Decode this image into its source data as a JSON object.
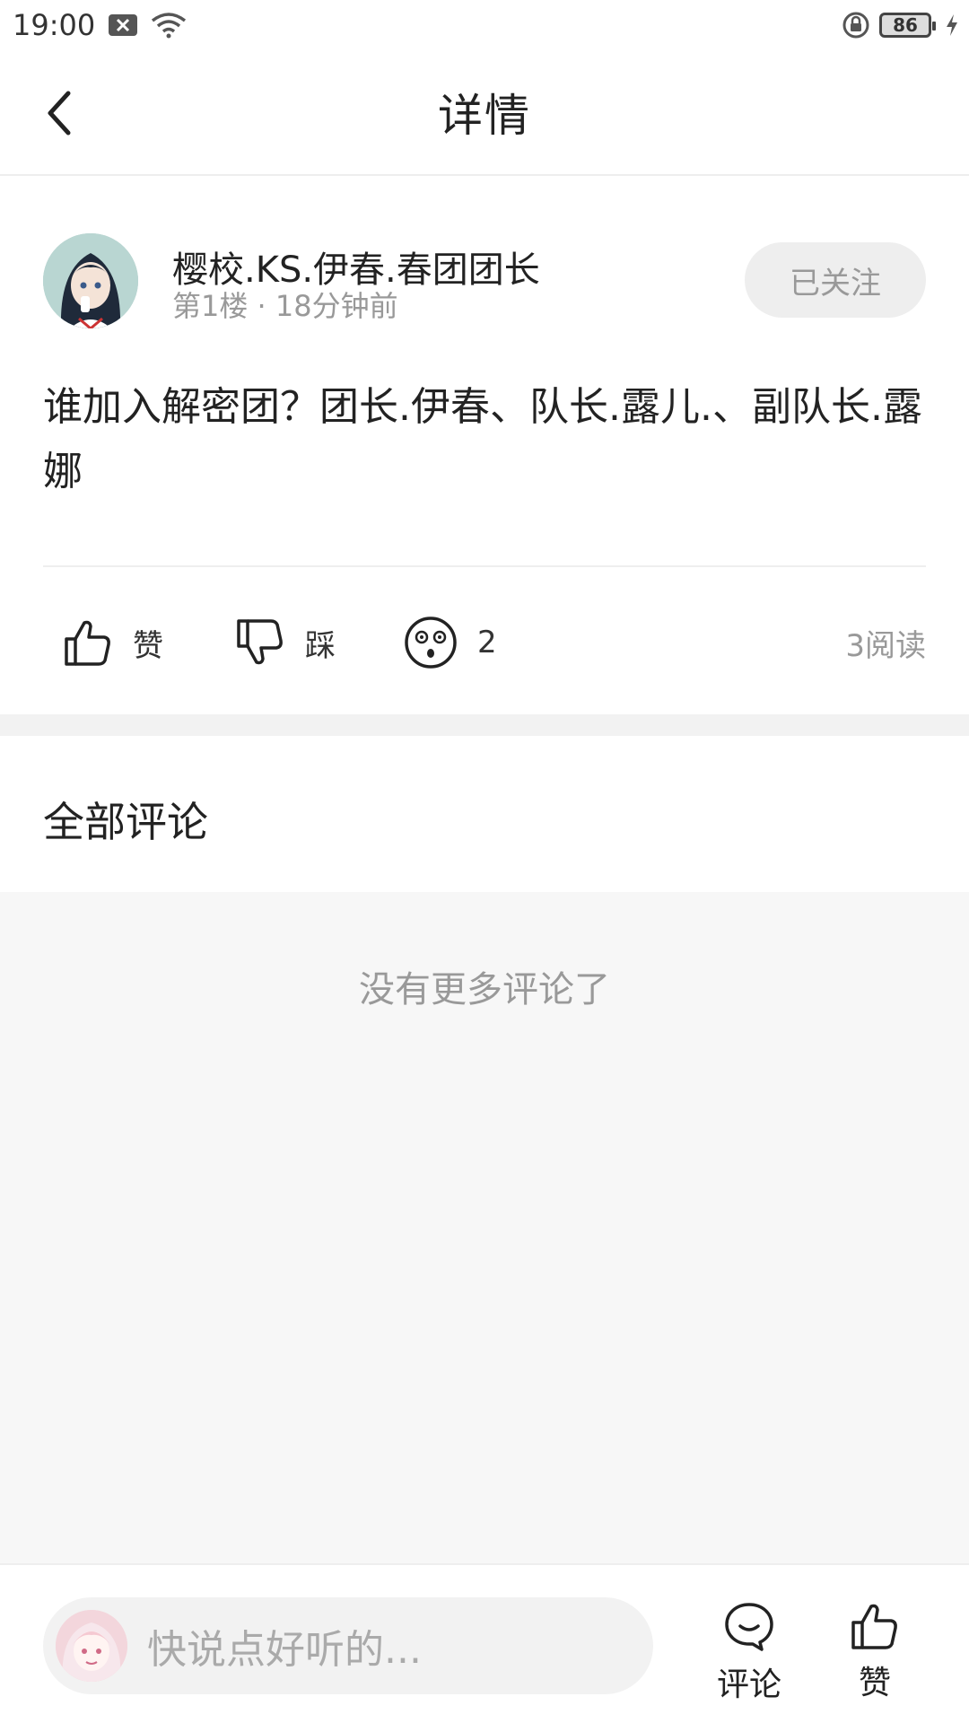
{
  "status_bar": {
    "time": "19:00",
    "battery": "86",
    "icons": [
      "notification-x-icon",
      "wifi-icon",
      "rotation-lock-icon",
      "battery-icon",
      "charging-icon"
    ]
  },
  "header": {
    "title": "详情",
    "back_icon": "chevron-left-icon"
  },
  "post": {
    "author_name": "樱校.KS.伊春.春团团长",
    "meta": "第1楼 · 18分钟前",
    "follow_label": "已关注",
    "content": "谁加入解密团？团长.伊春、队长.露儿.、副队长.露娜",
    "actions": {
      "like_label": "赞",
      "dislike_label": "踩",
      "emoji_count": "2"
    },
    "read_count": "3阅读"
  },
  "comments": {
    "title": "全部评论",
    "empty_text": "没有更多评论了"
  },
  "bottom_bar": {
    "input_placeholder": "快说点好听的...",
    "comment_label": "评论",
    "like_label": "赞"
  },
  "colors": {
    "text_primary": "#222222",
    "text_secondary": "#999999",
    "divider": "#eeeeee",
    "section_bg": "#f7f7f7"
  }
}
